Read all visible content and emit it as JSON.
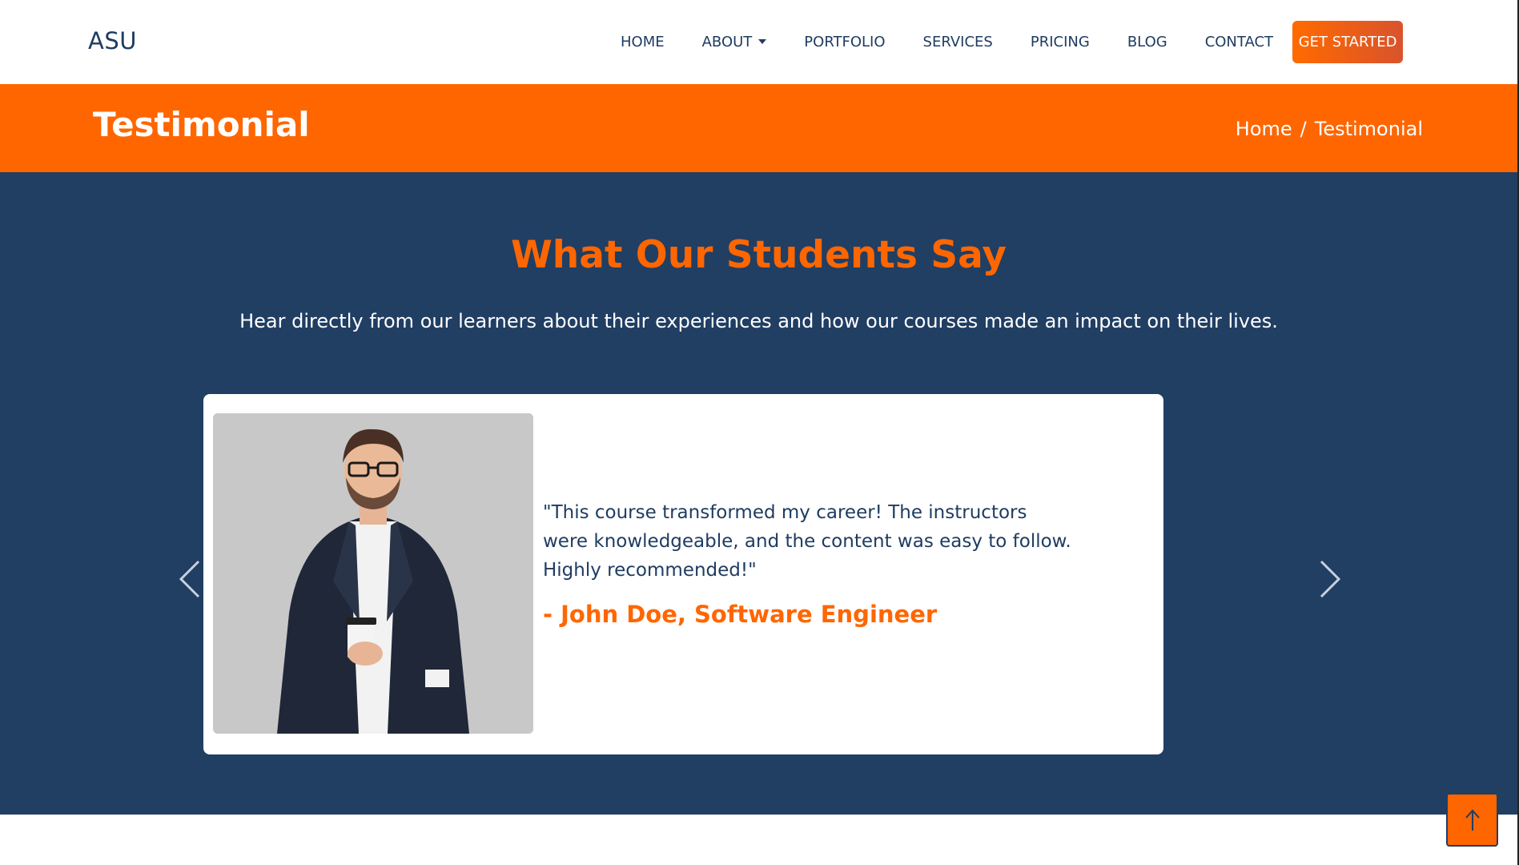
{
  "brand": "ASU",
  "nav": {
    "items": [
      {
        "label": "Home",
        "dropdown": false
      },
      {
        "label": "About",
        "dropdown": true
      },
      {
        "label": "Portfolio",
        "dropdown": false
      },
      {
        "label": "Services",
        "dropdown": false
      },
      {
        "label": "Pricing",
        "dropdown": false
      },
      {
        "label": "Blog",
        "dropdown": false
      },
      {
        "label": "Contact",
        "dropdown": false
      }
    ],
    "cta_label": "Get Started"
  },
  "banner": {
    "title": "Testimonial",
    "breadcrumb": {
      "home": "Home",
      "separator": "/",
      "current": "Testimonial"
    }
  },
  "testimonials": {
    "heading": "What Our Students Say",
    "subheading": "Hear directly from our learners about their experiences and how our courses made an impact on their lives.",
    "quote": "\"This course transformed my career! The instructors were knowledgeable, and the content was easy to follow. Highly recommended!\"",
    "author": "- John Doe, Software Engineer",
    "prev_icon": "chevron-left-icon",
    "next_icon": "chevron-right-icon"
  },
  "back_to_top_icon": "arrow-up-icon",
  "colors": {
    "accent": "#ff6600",
    "navy": "#213e63",
    "text_dark": "#1f3c61",
    "white": "#ffffff"
  }
}
